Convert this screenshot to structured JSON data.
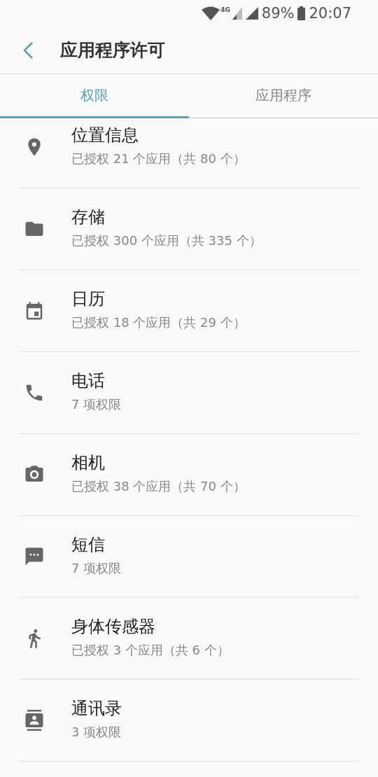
{
  "status_bar": {
    "network_type": "4G",
    "battery": "89%",
    "time": "20:07"
  },
  "header": {
    "title": "应用程序许可"
  },
  "tabs": [
    {
      "label": "权限",
      "selected": true
    },
    {
      "label": "应用程序",
      "selected": false
    }
  ],
  "permissions": [
    {
      "kind": "location",
      "title": "位置信息",
      "summary": "已授权 21 个应用（共 80 个）"
    },
    {
      "kind": "storage",
      "title": "存储",
      "summary": "已授权 300 个应用（共 335 个）"
    },
    {
      "kind": "calendar",
      "title": "日历",
      "summary": "已授权 18 个应用（共 29 个）"
    },
    {
      "kind": "phone",
      "title": "电话",
      "summary": "7 项权限"
    },
    {
      "kind": "camera",
      "title": "相机",
      "summary": "已授权 38 个应用（共 70 个）"
    },
    {
      "kind": "sms",
      "title": "短信",
      "summary": "7 项权限"
    },
    {
      "kind": "sensors",
      "title": "身体传感器",
      "summary": "已授权 3 个应用（共 6 个）"
    },
    {
      "kind": "contacts",
      "title": "通讯录",
      "summary": "3 项权限"
    }
  ]
}
